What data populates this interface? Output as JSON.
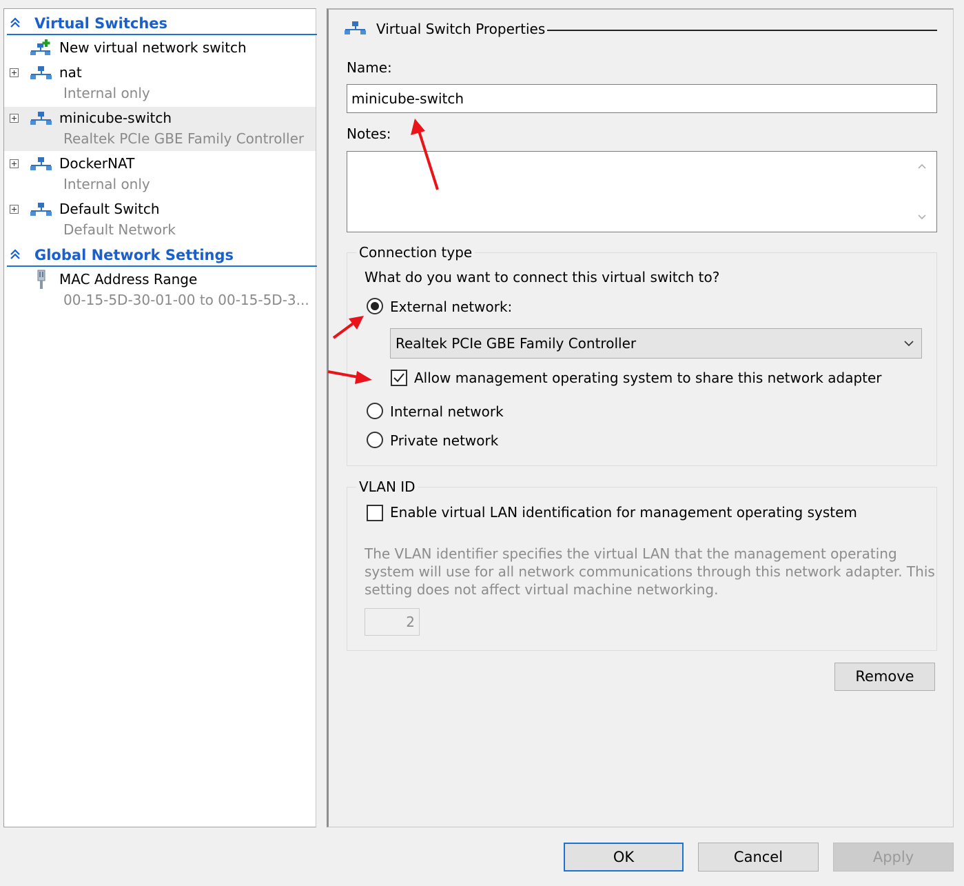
{
  "left_pane": {
    "virtual_switches_header": "Virtual Switches",
    "new_switch_label": "New virtual network switch",
    "switches": [
      {
        "name": "nat",
        "detail": "Internal only"
      },
      {
        "name": "minicube-switch",
        "detail": "Realtek PCIe GBE Family Controller"
      },
      {
        "name": "DockerNAT",
        "detail": "Internal only"
      },
      {
        "name": "Default Switch",
        "detail": "Default Network"
      }
    ],
    "global_header": "Global Network Settings",
    "mac_range": {
      "name": "MAC Address Range",
      "detail": "00-15-5D-30-01-00 to 00-15-5D-3..."
    }
  },
  "properties": {
    "title": "Virtual Switch Properties",
    "name_label": "Name:",
    "name_value": "minicube-switch",
    "notes_label": "Notes:",
    "notes_value": "",
    "connection_type": {
      "legend": "Connection type",
      "question": "What do you want to connect this virtual switch to?",
      "external_label": "External network:",
      "adapter_selected": "Realtek PCIe GBE Family Controller",
      "allow_management_label": "Allow management operating system to share this network adapter",
      "allow_management_checked": true,
      "internal_label": "Internal network",
      "private_label": "Private network",
      "selected": "external"
    },
    "vlan": {
      "legend": "VLAN ID",
      "enable_label": "Enable virtual LAN identification for management operating system",
      "enable_checked": false,
      "description_line1": "The VLAN identifier specifies the virtual LAN that the management operating",
      "description_line2": "system will use for all network communications through this network adapter. This",
      "description_line3": "setting does not affect virtual machine networking.",
      "vlan_value": "2"
    },
    "remove_label": "Remove"
  },
  "footer": {
    "ok_label": "OK",
    "cancel_label": "Cancel",
    "apply_label": "Apply"
  },
  "colors": {
    "accent_blue": "#1a5fcc",
    "annotation_red": "#e8141a",
    "selected_row": "#ececec"
  }
}
